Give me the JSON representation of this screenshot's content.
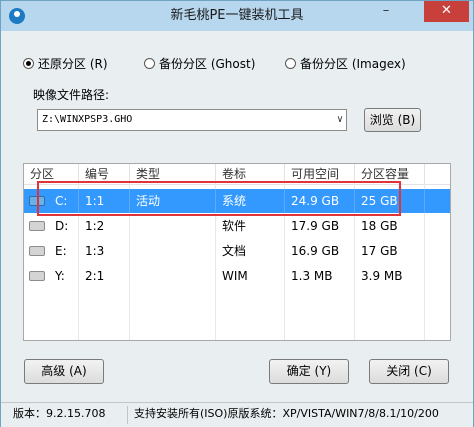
{
  "window": {
    "title": "新毛桃PE一键装机工具",
    "minimize_glyph": "–",
    "close_glyph": "✕"
  },
  "mode_options": [
    {
      "label": "还原分区 (R)",
      "selected": true
    },
    {
      "label": "备份分区 (Ghost)",
      "selected": false
    },
    {
      "label": "备份分区 (Imagex)",
      "selected": false
    }
  ],
  "image_path": {
    "label": "映像文件路径:",
    "value": "Z:\\WINXPSP3.GHO",
    "dropdown_glyph": "∨",
    "browse_label": "浏览 (B)"
  },
  "partition_table": {
    "columns": [
      "分区",
      "编号",
      "类型",
      "卷标",
      "可用空间",
      "分区容量"
    ],
    "rows": [
      {
        "drive": "C:",
        "number": "1:1",
        "type": "活动",
        "volume": "系统",
        "free": "24.9 GB",
        "capacity": "25 GB",
        "selected": true
      },
      {
        "drive": "D:",
        "number": "1:2",
        "type": "",
        "volume": "软件",
        "free": "17.9 GB",
        "capacity": "18 GB",
        "selected": false
      },
      {
        "drive": "E:",
        "number": "1:3",
        "type": "",
        "volume": "文档",
        "free": "16.9 GB",
        "capacity": "17 GB",
        "selected": false
      },
      {
        "drive": "Y:",
        "number": "2:1",
        "type": "",
        "volume": "WIM",
        "free": "1.3 MB",
        "capacity": "3.9 MB",
        "selected": false
      }
    ]
  },
  "buttons": {
    "advanced": "高级 (A)",
    "ok": "确定 (Y)",
    "close": "关闭 (C)"
  },
  "status_bar": {
    "version": "版本：9.2.15.708",
    "support": "支持安装所有(ISO)原版系统：XP/VISTA/WIN7/8/8.1/10/200"
  },
  "colors": {
    "selection": "#3399ff",
    "highlight_box": "#e0343a",
    "close_button": "#c8403b",
    "titlebar": "#b7d7ee"
  }
}
